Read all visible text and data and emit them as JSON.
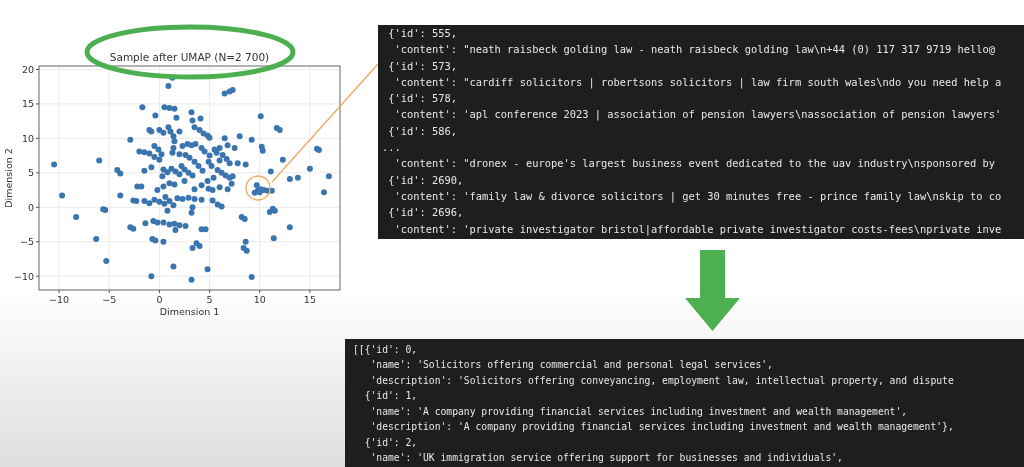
{
  "chart": {
    "chart_data": {
      "type": "scatter",
      "title": "Sample after UMAP (N=2 700)",
      "xlabel": "Dimension 1",
      "ylabel": "Dimension 2",
      "xlim": [
        -12,
        18
      ],
      "ylim": [
        -12,
        20.5
      ],
      "grid": true,
      "xticks": [
        {
          "value": -10,
          "label": "−10"
        },
        {
          "value": -5,
          "label": "−5"
        },
        0,
        5,
        10,
        15
      ],
      "yticks": [
        {
          "value": -10,
          "label": "−10"
        },
        {
          "value": -5,
          "label": "−5"
        },
        0,
        5,
        10,
        15,
        20
      ],
      "x": [
        1.3,
        0.9,
        6.5,
        7,
        7.3,
        -1.7,
        0.5,
        1,
        1.5,
        3.2,
        -0.4,
        1.7,
        3.3,
        4.1,
        10.1,
        11.7,
        12,
        8,
        9.2,
        10.2,
        10.3,
        15.7,
        15.9,
        12.3,
        -10.5,
        -6,
        -4.2,
        -3.9,
        11.1,
        15,
        13.8,
        13,
        16.9,
        -9.7,
        -3.9,
        16.4,
        -5.6,
        -5.4,
        11,
        11.5,
        11.3,
        -8.3,
        8.2,
        8.5,
        -2.9,
        -2.6,
        13,
        4.2,
        4.6,
        -6.3,
        11.4,
        -0.7,
        -0.4,
        0.4,
        3.7,
        3.3,
        4,
        8.6,
        8.4,
        8.7,
        -5.3,
        1.4,
        4.8,
        -0.8,
        3.2,
        9.2,
        -1.4,
        9.5,
        9.8,
        10.1,
        10.4,
        10.8,
        11.2,
        9.7,
        10,
        -1,
        -0.8,
        0,
        0.4,
        0.9,
        1.1,
        1.4,
        1.5,
        1.4,
        1.3,
        2,
        3.5,
        4,
        4.4,
        4.8,
        5,
        6.5,
        -2.9,
        -0.5,
        -0.1,
        0.2,
        -2,
        -1.5,
        -1,
        -0.5,
        0,
        2.3,
        2.8,
        3.6,
        4.2,
        4.5,
        5,
        5.5,
        6,
        6.8,
        7.5,
        6.3,
        6.7,
        7,
        7.8,
        8.6,
        2,
        2.6,
        3,
        3.5,
        3.9,
        4.3,
        2.2,
        2.5,
        2.9,
        3.3,
        -1.5,
        -0.8,
        0.4,
        0.3,
        0.8,
        1.2,
        1.6,
        2,
        2.5,
        5.2,
        5.8,
        6.2,
        6.6,
        7,
        7.3,
        7.2,
        5.4,
        4.8,
        4.2,
        3.5,
        4.9,
        5.3,
        6,
        6.8,
        1,
        1.5,
        0.4,
        -0.2,
        0.6,
        -1.8,
        -2.2,
        -2.6,
        -2.3,
        -1.5,
        -1,
        -0.5,
        0,
        0.5,
        1,
        1.4,
        0.8,
        1.8,
        2.3,
        2.9,
        3.5,
        4.2,
        5.3,
        5.8,
        6.2,
        3.3,
        3.2,
        -0.6,
        -0.2,
        0.4,
        1,
        1.5,
        2,
        2.6,
        1.6,
        6,
        5.7,
        3.2,
        4.9
      ],
      "series": [
        {
          "color": "#3a75b0",
          "values": [
            18.8,
            17.6,
            16.5,
            16.8,
            17,
            14.5,
            14.5,
            14.4,
            14.3,
            13.8,
            13.3,
            13,
            12.6,
            12.9,
            13.2,
            11.5,
            11.2,
            10.3,
            9.8,
            8.8,
            8.2,
            8.5,
            8.3,
            6.9,
            6.2,
            6.8,
            5.4,
            4.9,
            5.2,
            5.6,
            4.3,
            4.1,
            4.5,
            1.7,
            1.7,
            2.2,
            -0.3,
            -0.4,
            -0.7,
            -0.5,
            -0.2,
            -1.4,
            -1.4,
            -1.7,
            -2.9,
            -3.1,
            -2.9,
            -3.2,
            -3.2,
            -4.6,
            -4.5,
            -4.6,
            -4.8,
            -5,
            -5.2,
            -5.9,
            -5.6,
            -5,
            -5.9,
            -6.3,
            -7.8,
            -8.6,
            -9,
            -10,
            -10.5,
            -10.1,
            -2.3,
            2.1,
            2.4,
            2.6,
            2.5,
            2.4,
            2.4,
            3.2,
            2.2,
            11.2,
            11,
            11.2,
            10.8,
            11.6,
            11,
            10.3,
            9.6,
            8.6,
            7.9,
            11,
            11.6,
            11.2,
            10.7,
            10.4,
            10.1,
            10,
            9.8,
            8.9,
            8.4,
            7.7,
            8.1,
            8,
            7.8,
            7.3,
            6.9,
            8.9,
            9.2,
            9.2,
            8.6,
            8.1,
            7.5,
            8.4,
            8.6,
            9,
            8.6,
            7.6,
            7,
            6.4,
            6.4,
            6.2,
            7.7,
            7.6,
            7.2,
            6.6,
            6,
            5.3,
            6,
            5.5,
            5,
            4.6,
            5.3,
            5.8,
            5.5,
            4.5,
            5.1,
            5.6,
            5.2,
            4.8,
            3.8,
            6,
            5.4,
            5,
            4.6,
            4.3,
            4.5,
            3.4,
            4.3,
            3.8,
            3.2,
            2.6,
            2.7,
            2.5,
            2.9,
            2.6,
            3.5,
            3.3,
            3,
            2.5,
            1.5,
            3,
            3,
            1,
            0.9,
            0.9,
            0.6,
            1.1,
            0.8,
            0.5,
            0.9,
            0.3,
            -0.5,
            1.3,
            1.2,
            1.4,
            1.2,
            1.1,
            1,
            0.4,
            0.1,
            0,
            -0.8,
            -2,
            -2.2,
            -2.2,
            -2.5,
            -2.4,
            -2.6,
            -2.7,
            -3.3,
            6.8,
            7.9,
            9,
            6.6
          ]
        }
      ]
    }
  },
  "input_panel": {
    "lines": [
      " {'id': 555,",
      "  'content': \"neath raisbeck golding law - neath raisbeck golding law\\n+44 (0) 117 317 9719 hello@",
      " {'id': 573,",
      "  'content': \"cardiff solicitors | robertsons solicitors | law firm south wales\\ndo you need help a",
      " {'id': 578,",
      "  'content': 'apl conference 2023 | association of pension lawyers\\nassociation of pension lawyers'",
      " {'id': 586,",
      "...",
      "  'content': \"dronex - europe's largest business event dedicated to the uav industry\\nsponsored by",
      " {'id': 2690,",
      "  'content': 'family law & divorce solicitors | get 30 minutes free - prince family law\\nskip to co",
      " {'id': 2696,",
      "  'content': 'private investigator bristol|affordable private investigator costs-fees\\nprivate inve"
    ]
  },
  "output_panel": {
    "lines": [
      "[[{'id': 0,",
      "   'name': 'Solicitors offering commercial and personal legal services',",
      "   'description': 'Solicitors offering conveyancing, employment law, intellectual property, and dispute",
      "  {'id': 1,",
      "   'name': 'A company providing financial services including investment and wealth management',",
      "   'description': 'A company providing financial services including investment and wealth management'},",
      "  {'id': 2,",
      "   'name': 'UK immigration service offering support for businesses and individuals',"
    ]
  }
}
